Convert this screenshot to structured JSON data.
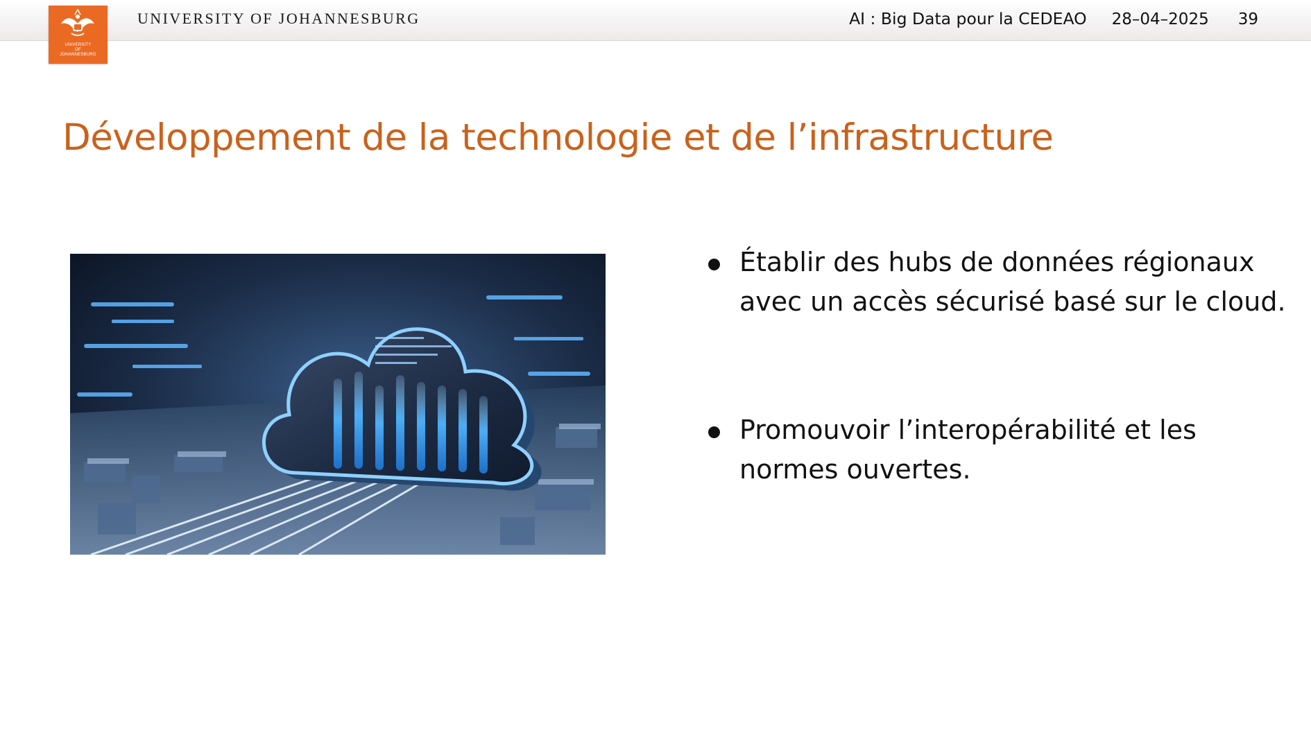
{
  "header": {
    "logo": {
      "icon": "university-crest-icon",
      "wordmark": [
        "UNIVERSITY",
        "OF",
        "JOHANNESBURG"
      ],
      "background_color": "#ea6a23"
    },
    "university_name": "UNIVERSITY OF JOHANNESBURG",
    "talk_title": "AI : Big Data pour la CEDEAO",
    "date": "28–04–2025",
    "page_number": "39"
  },
  "slide": {
    "title": "Développement de la technologie et de l’infrastructure",
    "title_color": "#c9621c",
    "image": {
      "icon": "cloud-computing-illustration"
    },
    "bullets": [
      {
        "text": "Établir des hubs de données régionaux avec un accès sécurisé basé sur le cloud."
      },
      {
        "text": "Promouvoir l’interopérabilité et les normes ouvertes."
      }
    ]
  }
}
